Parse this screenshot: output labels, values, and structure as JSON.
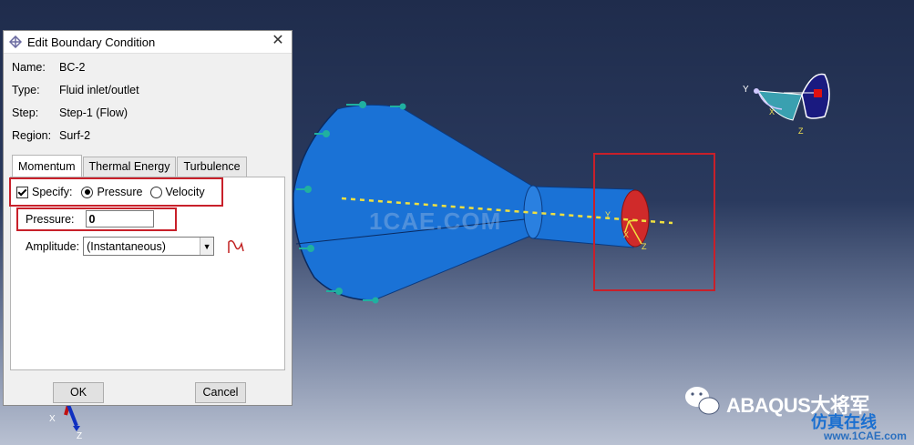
{
  "dialog": {
    "title": "Edit Boundary Condition",
    "close_label": "✕",
    "name_key": "Name:",
    "name_value": "BC-2",
    "type_key": "Type:",
    "type_value": "Fluid inlet/outlet",
    "step_key": "Step:",
    "step_value": "Step-1 (Flow)",
    "region_key": "Region:",
    "region_value": "Surf-2",
    "tabs": [
      {
        "label": "Momentum",
        "active": true
      },
      {
        "label": "Thermal Energy",
        "active": false
      },
      {
        "label": "Turbulence",
        "active": false
      }
    ],
    "specify_label": "Specify:",
    "radio_pressure": "Pressure",
    "radio_velocity": "Velocity",
    "pressure_label": "Pressure:",
    "pressure_value": "0",
    "amplitude_label": "Amplitude:",
    "amplitude_value": "(Instantaneous)",
    "ok_label": "OK",
    "cancel_label": "Cancel"
  },
  "viewport": {
    "watermark_center": "1CAE.COM",
    "brand": "ABAQUS大将军",
    "site_cn": "仿真在线",
    "site_url": "www.1CAE.com",
    "triad_top_labels": {
      "y": "Y",
      "x": "X",
      "z": "Z"
    },
    "triad_outlet_labels": {
      "y": "Y",
      "x": "X",
      "z": "Z"
    },
    "triad_bottom_labels": {
      "x": "X",
      "z": "Z"
    }
  },
  "colors": {
    "model_blue": "#1a72d6",
    "highlight_red": "#c8202a",
    "axis_yellow": "#f0e040",
    "arrow_teal": "#20b0a0"
  }
}
